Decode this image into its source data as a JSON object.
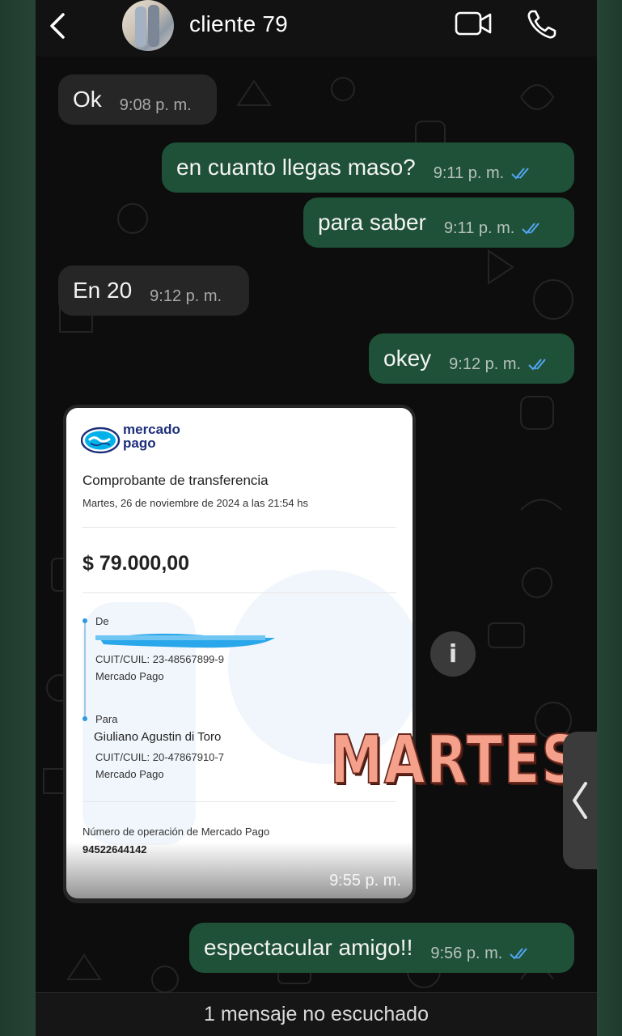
{
  "header": {
    "contact_name": "cliente 79",
    "icons": [
      "back-arrow-icon",
      "video-call-icon",
      "phone-icon"
    ]
  },
  "messages": [
    {
      "direction": "incoming",
      "text": "Ok",
      "time": "9:08 p. m."
    },
    {
      "direction": "outgoing",
      "text": "en cuanto llegas maso?",
      "time": "9:11 p. m.",
      "read": true
    },
    {
      "direction": "outgoing",
      "text": "para saber",
      "time": "9:11 p. m.",
      "read": true
    },
    {
      "direction": "incoming",
      "text": "En 20",
      "time": "9:12 p. m."
    },
    {
      "direction": "outgoing",
      "text": "okey",
      "time": "9:12 p. m.",
      "read": true
    },
    {
      "direction": "outgoing",
      "text": "espectacular amigo!!",
      "time": "9:56 p. m.",
      "read": true
    }
  ],
  "receipt": {
    "brand": [
      "mercado",
      "pago"
    ],
    "title": "Comprobante de transferencia",
    "date": "Martes, 26 de noviembre de 2024 a las 21:54 hs",
    "amount": "$ 79.000,00",
    "from_label": "De",
    "from_cuit": "CUIT/CUIL: 23-48567899-9",
    "from_bank": "Mercado Pago",
    "to_label": "Para",
    "to_name": "Giuliano Agustin di Toro",
    "to_cuit": "CUIT/CUIL: 20-47867910-7",
    "to_bank": "Mercado Pago",
    "operation_label": "Número de operación de Mercado Pago",
    "operation_number": "94522644142",
    "time": "9:55 p. m."
  },
  "overlay": {
    "text": "MARTES",
    "color": "#f5a08a"
  },
  "info_button": "i",
  "footer": {
    "text": "1 mensaje no escuchado"
  },
  "colors": {
    "incoming_bubble": "#262626",
    "outgoing_bubble": "#1e5137",
    "read_ticks": "#53a6f5",
    "background": "#0d0d0d"
  }
}
